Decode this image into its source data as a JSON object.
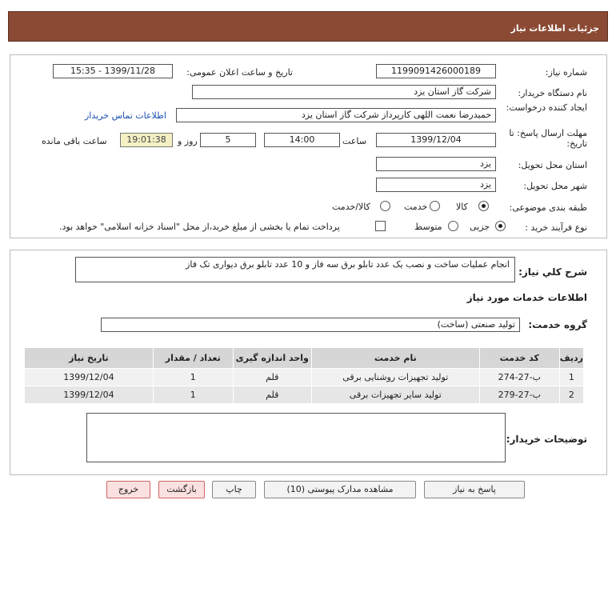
{
  "header": {
    "title": "جزئیات اطلاعات نیاز"
  },
  "form": {
    "need_number_label": "شماره نیاز:",
    "need_number": "1199091426000189",
    "announce_label": "تاریخ و ساعت اعلان عمومی:",
    "announce_value": "1399/11/28 - 15:35",
    "buyer_label": "نام دستگاه خریدار:",
    "buyer_value": "شرکت گاز استان یزد",
    "creator_label": "ایجاد کننده درخواست:",
    "creator_value": "حمیدرضا نعمت اللهی کارپرداز  شرکت گاز استان یزد",
    "contact_link": "اطلاعات تماس خریدار",
    "deadline_label": "مهلت ارسال پاسخ: تا تاریخ:",
    "deadline_date": "1399/12/04",
    "time_label": "ساعت",
    "deadline_time": "14:00",
    "days_value": "5",
    "days_label": "روز و",
    "remaining_time": "19:01:38",
    "remaining_label": "ساعت باقی مانده",
    "province_label": "استان محل تحویل:",
    "province_value": "یزد",
    "city_label": "شهر محل تحویل:",
    "city_value": "یزد",
    "category_label": "طبقه بندی موضوعی:",
    "category_options": [
      "کالا",
      "خدمت",
      "کالا/خدمت"
    ],
    "process_label": "نوع فرآیند خرید :",
    "process_options": [
      "جزیی",
      "متوسط"
    ],
    "payment_note": "پرداخت تمام یا بخشی از مبلغ خرید،از محل \"اسناد خزانه اسلامی\" خواهد بود."
  },
  "details": {
    "description_label": "شرح کلي نياز:",
    "description_value": "انجام عملیات ساخت و نصب یک عدد تابلو برق سه فاز و 10 عدد تابلو برق دیواری تک فاز",
    "services_heading": "اطلاعات خدمات مورد نیاز",
    "service_group_label": "گروه خدمت:",
    "service_group_value": "تولید صنعتی (ساخت)"
  },
  "table": {
    "headers": [
      "ردیف",
      "کد خدمت",
      "نام خدمت",
      "واحد اندازه گیری",
      "تعداد / مقدار",
      "تاریخ نیاز"
    ],
    "rows": [
      [
        "1",
        "ب-27-274",
        "تولید تجهیزات روشنایی برقی",
        "قلم",
        "1",
        "1399/12/04"
      ],
      [
        "2",
        "ب-27-279",
        "تولید سایر تجهیزات برقی",
        "قلم",
        "1",
        "1399/12/04"
      ]
    ]
  },
  "buyer_notes_label": "توضیحات خریدار:",
  "buttons": {
    "reply": "پاسخ به نیاز",
    "attachments": "مشاهده مدارک پیوستی (10)",
    "print": "چاپ",
    "back": "بازگشت",
    "exit": "خروج"
  }
}
